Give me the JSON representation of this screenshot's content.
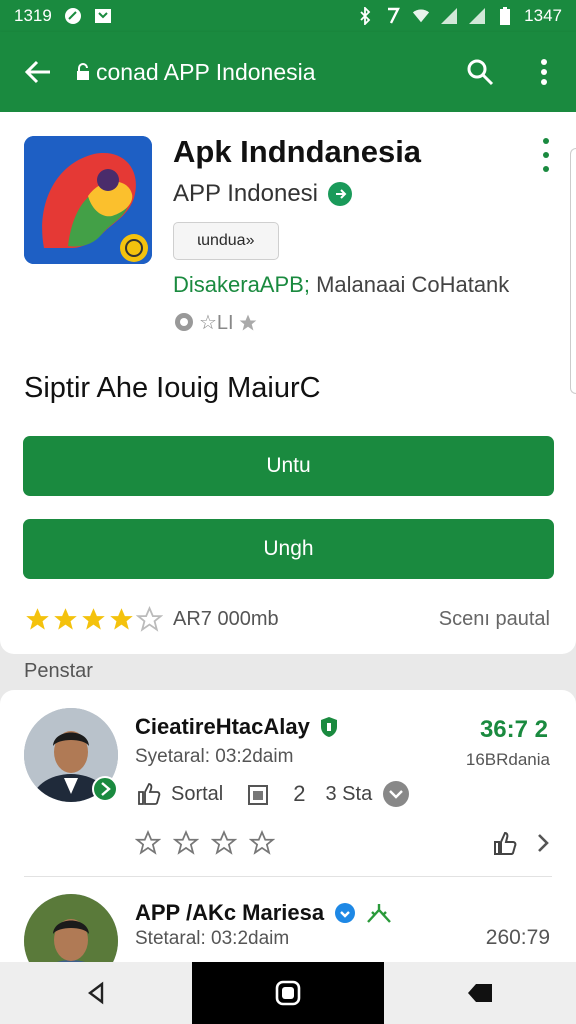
{
  "status_bar": {
    "time": "1319",
    "clock_right": "1347",
    "icons_left": [
      "leaf-icon",
      "store-icon"
    ],
    "icons_right": [
      "bluetooth-icon",
      "nfc-icon",
      "wifi-icon",
      "signal-icon",
      "signal-icon",
      "battery-icon"
    ]
  },
  "app_bar": {
    "title": "conad APP Indonesia",
    "icons": [
      "back-arrow-icon",
      "lock-icon",
      "search-icon",
      "more-vert-icon"
    ]
  },
  "app": {
    "name": "Apk Indndanesia",
    "developer": "APP Indonesi",
    "chip_label": "ɩundua»",
    "meta_green": "DisakeraAPB;",
    "meta_gray": " Malanaai CoHatank",
    "small_row": "☆LI",
    "icon_name": "parrot-app-icon"
  },
  "section_title": "Siptir Ahe Iouig MaiurC",
  "buttons": {
    "primary": "Untu",
    "secondary": "Ungh"
  },
  "rating": {
    "stars_filled": 4,
    "stars_total": 5,
    "text": "AR7 000mb",
    "see_all": "Scenı pautal"
  },
  "reviews": {
    "label": "Penstar",
    "items": [
      {
        "name": "CieatireHtacAlay",
        "subtitle": "Syetaral: 03:2daim",
        "score": "36:7 2",
        "score_sub": "16BRdania",
        "action_label": "Sortal",
        "count": "2",
        "stars_label": "3 Sta"
      },
      {
        "name": "APP /AKc Mariesa",
        "subtitle": "Stetaral: 03:2daim",
        "score": "260:79"
      }
    ]
  },
  "colors": {
    "brand_green": "#1a8a3f",
    "accent_yellow": "#f4c20d"
  }
}
